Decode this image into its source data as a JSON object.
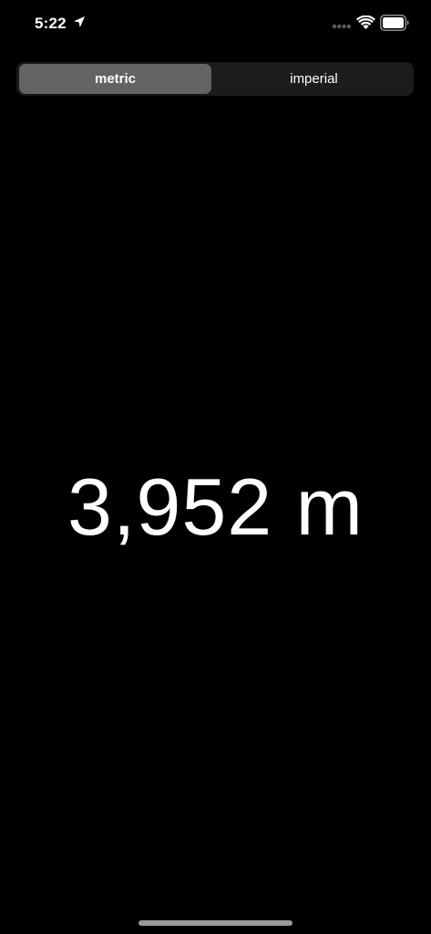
{
  "status_bar": {
    "time": "5:22",
    "icons": [
      "location-arrow-icon",
      "signal-dots-icon",
      "wifi-icon",
      "battery-icon"
    ]
  },
  "unit_toggle": {
    "options": [
      {
        "label": "metric",
        "selected": true
      },
      {
        "label": "imperial",
        "selected": false
      }
    ]
  },
  "display": {
    "distance_text": "3,952 m"
  },
  "colors": {
    "background": "#000000",
    "segment_track": "#1c1c1e",
    "segment_selected": "#636366",
    "text": "#ffffff"
  }
}
